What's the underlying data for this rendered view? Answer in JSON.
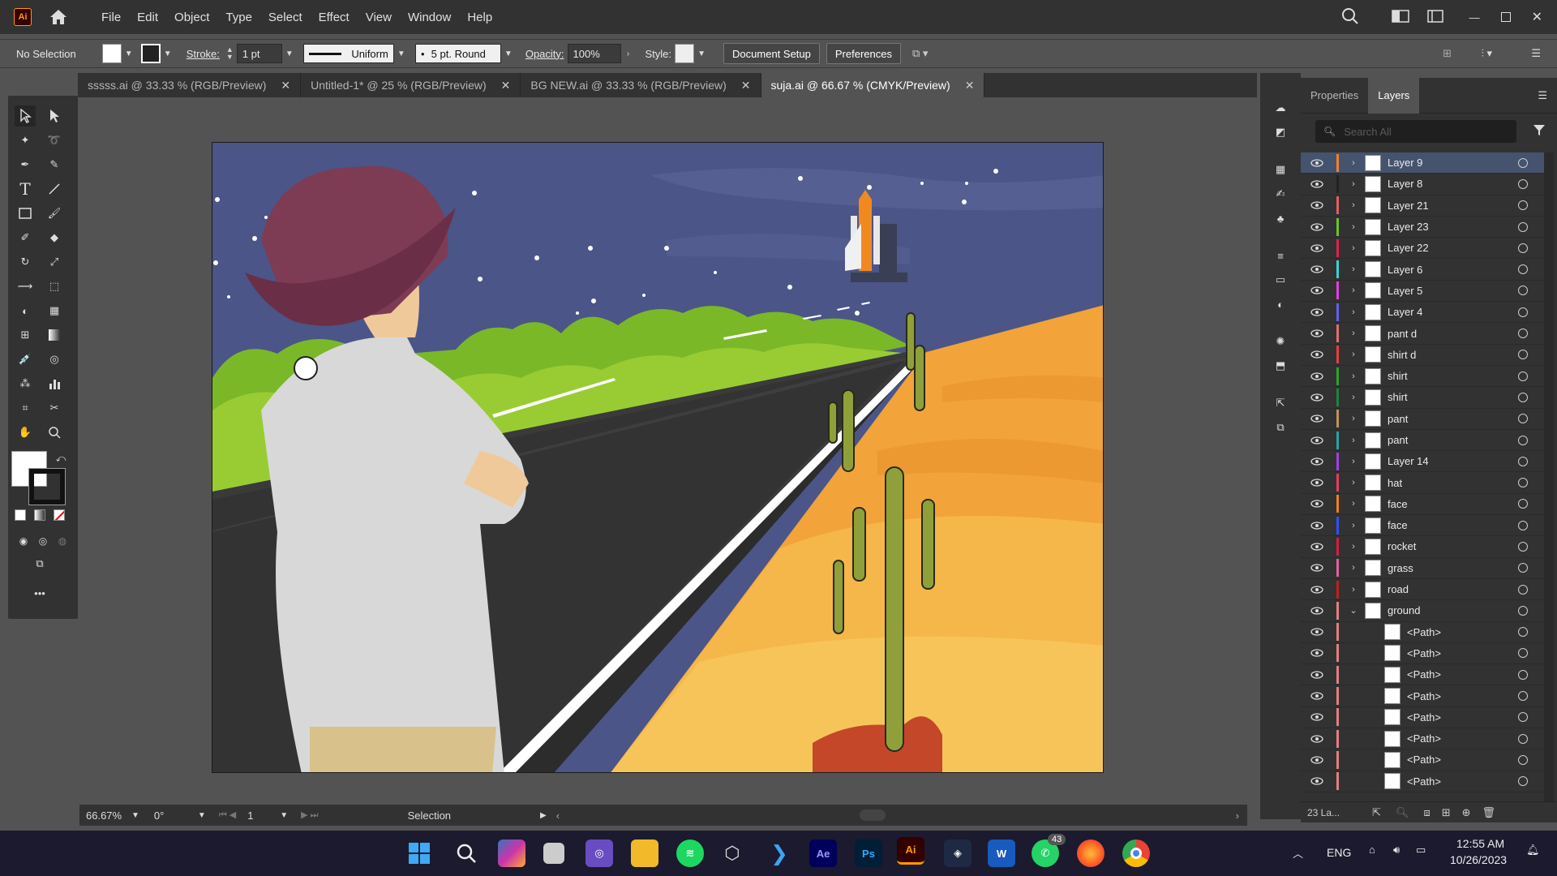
{
  "app": {
    "logo": "Ai",
    "name": "Adobe Illustrator"
  },
  "menu": [
    "File",
    "Edit",
    "Object",
    "Type",
    "Select",
    "Effect",
    "View",
    "Window",
    "Help"
  ],
  "control": {
    "selection": "No Selection",
    "stroke_label": "Stroke:",
    "stroke_value": "1 pt",
    "profile": "Uniform",
    "brush": "5 pt. Round",
    "opacity_label": "Opacity:",
    "opacity_value": "100%",
    "style_label": "Style:",
    "doc_setup": "Document Setup",
    "preferences": "Preferences"
  },
  "tabs": [
    {
      "label": "sssss.ai @ 33.33 % (RGB/Preview)",
      "active": false
    },
    {
      "label": "Untitled-1* @ 25 % (RGB/Preview)",
      "active": false
    },
    {
      "label": "BG NEW.ai @ 33.33 % (RGB/Preview)",
      "active": false
    },
    {
      "label": "suja.ai @ 66.67 % (CMYK/Preview)",
      "active": true
    }
  ],
  "panel": {
    "tabs": [
      "Properties",
      "Layers"
    ],
    "active_tab": "Layers",
    "search_placeholder": "Search All",
    "footer_count": "23 La..."
  },
  "layers": [
    {
      "name": "Layer 9",
      "color": "#f08030",
      "expanded": false,
      "selected": true
    },
    {
      "name": "Layer 8",
      "color": "#222222",
      "expanded": false
    },
    {
      "name": "Layer 21",
      "color": "#e06060",
      "expanded": false
    },
    {
      "name": "Layer 23",
      "color": "#70c030",
      "expanded": false
    },
    {
      "name": "Layer 22",
      "color": "#e02050",
      "expanded": false
    },
    {
      "name": "Layer 6",
      "color": "#40d0d0",
      "expanded": false
    },
    {
      "name": "Layer 5",
      "color": "#e040e0",
      "expanded": false
    },
    {
      "name": "Layer 4",
      "color": "#6060f0",
      "expanded": false
    },
    {
      "name": "pant d",
      "color": "#e07070",
      "expanded": false
    },
    {
      "name": "shirt d",
      "color": "#e04040",
      "expanded": false
    },
    {
      "name": "shirt",
      "color": "#30a030",
      "expanded": false
    },
    {
      "name": "shirt",
      "color": "#208040",
      "expanded": false
    },
    {
      "name": "pant",
      "color": "#c09060",
      "expanded": false
    },
    {
      "name": "pant",
      "color": "#30a0a0",
      "expanded": false
    },
    {
      "name": "Layer 14",
      "color": "#a040e0",
      "expanded": false
    },
    {
      "name": "hat",
      "color": "#e04060",
      "expanded": false
    },
    {
      "name": "face",
      "color": "#f08020",
      "expanded": false
    },
    {
      "name": "face",
      "color": "#3050f0",
      "expanded": false
    },
    {
      "name": "rocket",
      "color": "#d02040",
      "expanded": false
    },
    {
      "name": "grass",
      "color": "#e060a0",
      "expanded": false
    },
    {
      "name": "road",
      "color": "#c02020",
      "expanded": false
    },
    {
      "name": "ground",
      "color": "#e08080",
      "expanded": true
    },
    {
      "name": "<Path>",
      "color": "#e08080",
      "child": true
    },
    {
      "name": "<Path>",
      "color": "#e08080",
      "child": true
    },
    {
      "name": "<Path>",
      "color": "#e08080",
      "child": true
    },
    {
      "name": "<Path>",
      "color": "#e08080",
      "child": true
    },
    {
      "name": "<Path>",
      "color": "#e08080",
      "child": true
    },
    {
      "name": "<Path>",
      "color": "#e08080",
      "child": true
    },
    {
      "name": "<Path>",
      "color": "#e08080",
      "child": true
    },
    {
      "name": "<Path>",
      "color": "#e08080",
      "child": true
    }
  ],
  "status": {
    "zoom": "66.67%",
    "rotation": "0°",
    "artboard": "1",
    "tool": "Selection"
  },
  "taskbar": {
    "lang": "ENG",
    "time": "12:55 AM",
    "date": "10/26/2023",
    "whatsapp_badge": "43",
    "apps": [
      "windows-start",
      "search",
      "copilot",
      "task-view",
      "camera",
      "file-explorer",
      "spotify",
      "box",
      "vscode",
      "after-effects",
      "photoshop",
      "illustrator",
      "davinci",
      "word",
      "whatsapp",
      "firefox",
      "chrome"
    ]
  }
}
